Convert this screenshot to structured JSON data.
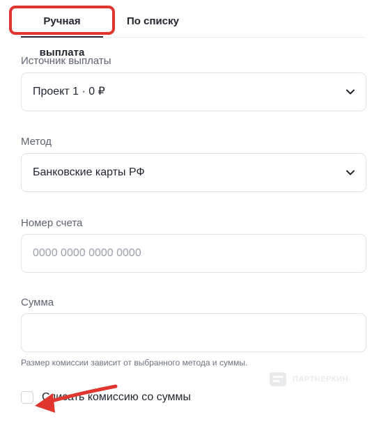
{
  "tabs": [
    {
      "label": "Ручная выплата",
      "active": true
    },
    {
      "label": "По списку",
      "active": false
    }
  ],
  "form": {
    "source": {
      "label": "Источник выплаты",
      "value": "Проект 1 · 0 ₽"
    },
    "method": {
      "label": "Метод",
      "value": "Банковские карты РФ"
    },
    "account": {
      "label": "Номер счета",
      "placeholder": "0000 0000 0000 0000",
      "value": ""
    },
    "amount": {
      "label": "Сумма",
      "placeholder": "",
      "value": ""
    },
    "hint": "Размер комиссии зависит от выбранного метода и суммы.",
    "deduct_fee": {
      "label": "Списать комиссию со суммы",
      "checked": false
    }
  },
  "watermark": {
    "text": "ПАРТНЕРКИН"
  },
  "icons": {
    "select_arrow": "chevron-down-icon",
    "annotation_arrow": "red-arrow-icon"
  },
  "colors": {
    "annotation": "#e0362f",
    "text": "#1f2430",
    "border": "#dfe2e8"
  }
}
